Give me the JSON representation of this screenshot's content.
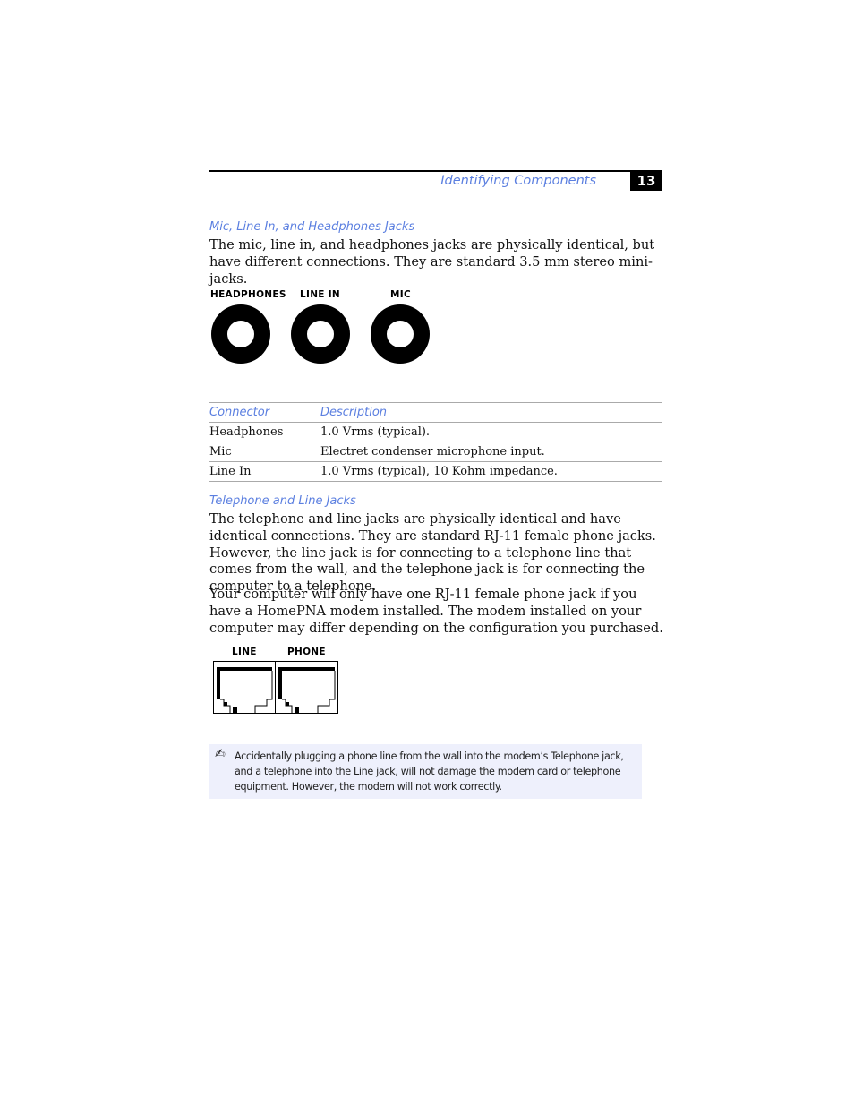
{
  "header": {
    "section_title": "Identifying Components",
    "page_number": "13"
  },
  "audio_section": {
    "heading": "Mic, Line In, and Headphones Jacks",
    "paragraph": "The mic, line in, and headphones jacks are physically identical, but have different connections. They are standard 3.5 mm stereo mini-jacks.",
    "jack_labels": [
      "HEADPHONES",
      "LINE IN",
      "MIC"
    ]
  },
  "connector_table": {
    "headers": [
      "Connector",
      "Description"
    ],
    "rows": [
      [
        "Headphones",
        "1.0 Vrms (typical)."
      ],
      [
        "Mic",
        "Electret condenser microphone input."
      ],
      [
        "Line In",
        "1.0 Vrms (typical), 10 Kohm impedance."
      ]
    ]
  },
  "telephone_section": {
    "heading": "Telephone and Line Jacks",
    "paragraph1": "The telephone and line jacks are physically identical and have identical connections. They are standard RJ-11 female phone jacks. However, the line jack is for connecting to a telephone line that comes from the wall, and the telephone jack is for connecting the computer to a telephone.",
    "paragraph2": "Your computer will only have one RJ-11 female phone jack if you have a HomePNA modem installed. The modem installed on your computer may differ depending on the configuration you purchased.",
    "jack_labels": [
      "LINE",
      "PHONE"
    ]
  },
  "note": {
    "icon": "note-pencil-icon",
    "text": "Accidentally plugging a phone line from the wall into the modem’s Telephone jack, and a telephone into the Line jack, will not damage the modem card or telephone equipment. However, the modem will not work correctly."
  },
  "colors": {
    "accent": "#5b7fe0",
    "note_background": "#eef0fc"
  }
}
